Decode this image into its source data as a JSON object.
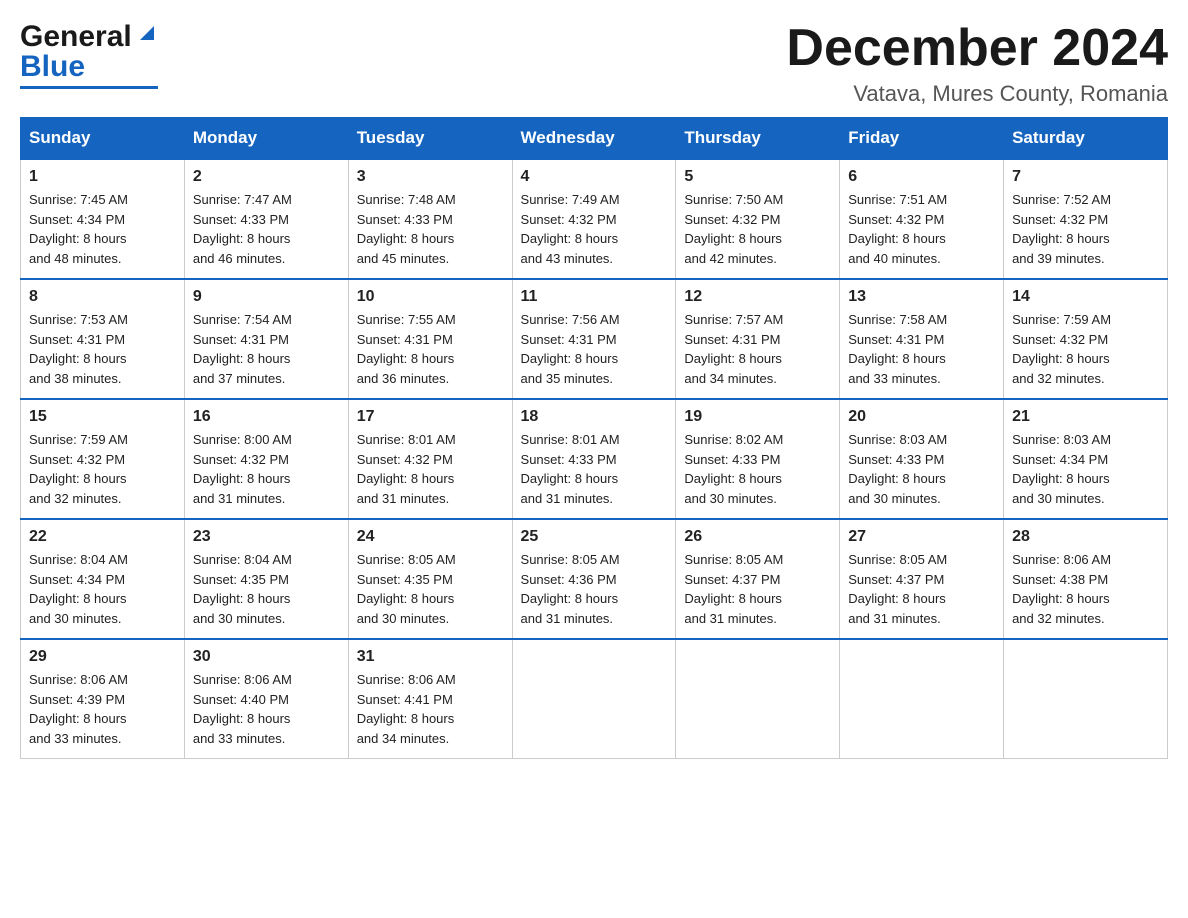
{
  "logo": {
    "general": "General",
    "blue": "Blue"
  },
  "header": {
    "month_title": "December 2024",
    "location": "Vatava, Mures County, Romania"
  },
  "days_of_week": [
    "Sunday",
    "Monday",
    "Tuesday",
    "Wednesday",
    "Thursday",
    "Friday",
    "Saturday"
  ],
  "weeks": [
    [
      {
        "day": "1",
        "sunrise": "7:45 AM",
        "sunset": "4:34 PM",
        "daylight": "8 hours and 48 minutes."
      },
      {
        "day": "2",
        "sunrise": "7:47 AM",
        "sunset": "4:33 PM",
        "daylight": "8 hours and 46 minutes."
      },
      {
        "day": "3",
        "sunrise": "7:48 AM",
        "sunset": "4:33 PM",
        "daylight": "8 hours and 45 minutes."
      },
      {
        "day": "4",
        "sunrise": "7:49 AM",
        "sunset": "4:32 PM",
        "daylight": "8 hours and 43 minutes."
      },
      {
        "day": "5",
        "sunrise": "7:50 AM",
        "sunset": "4:32 PM",
        "daylight": "8 hours and 42 minutes."
      },
      {
        "day": "6",
        "sunrise": "7:51 AM",
        "sunset": "4:32 PM",
        "daylight": "8 hours and 40 minutes."
      },
      {
        "day": "7",
        "sunrise": "7:52 AM",
        "sunset": "4:32 PM",
        "daylight": "8 hours and 39 minutes."
      }
    ],
    [
      {
        "day": "8",
        "sunrise": "7:53 AM",
        "sunset": "4:31 PM",
        "daylight": "8 hours and 38 minutes."
      },
      {
        "day": "9",
        "sunrise": "7:54 AM",
        "sunset": "4:31 PM",
        "daylight": "8 hours and 37 minutes."
      },
      {
        "day": "10",
        "sunrise": "7:55 AM",
        "sunset": "4:31 PM",
        "daylight": "8 hours and 36 minutes."
      },
      {
        "day": "11",
        "sunrise": "7:56 AM",
        "sunset": "4:31 PM",
        "daylight": "8 hours and 35 minutes."
      },
      {
        "day": "12",
        "sunrise": "7:57 AM",
        "sunset": "4:31 PM",
        "daylight": "8 hours and 34 minutes."
      },
      {
        "day": "13",
        "sunrise": "7:58 AM",
        "sunset": "4:31 PM",
        "daylight": "8 hours and 33 minutes."
      },
      {
        "day": "14",
        "sunrise": "7:59 AM",
        "sunset": "4:32 PM",
        "daylight": "8 hours and 32 minutes."
      }
    ],
    [
      {
        "day": "15",
        "sunrise": "7:59 AM",
        "sunset": "4:32 PM",
        "daylight": "8 hours and 32 minutes."
      },
      {
        "day": "16",
        "sunrise": "8:00 AM",
        "sunset": "4:32 PM",
        "daylight": "8 hours and 31 minutes."
      },
      {
        "day": "17",
        "sunrise": "8:01 AM",
        "sunset": "4:32 PM",
        "daylight": "8 hours and 31 minutes."
      },
      {
        "day": "18",
        "sunrise": "8:01 AM",
        "sunset": "4:33 PM",
        "daylight": "8 hours and 31 minutes."
      },
      {
        "day": "19",
        "sunrise": "8:02 AM",
        "sunset": "4:33 PM",
        "daylight": "8 hours and 30 minutes."
      },
      {
        "day": "20",
        "sunrise": "8:03 AM",
        "sunset": "4:33 PM",
        "daylight": "8 hours and 30 minutes."
      },
      {
        "day": "21",
        "sunrise": "8:03 AM",
        "sunset": "4:34 PM",
        "daylight": "8 hours and 30 minutes."
      }
    ],
    [
      {
        "day": "22",
        "sunrise": "8:04 AM",
        "sunset": "4:34 PM",
        "daylight": "8 hours and 30 minutes."
      },
      {
        "day": "23",
        "sunrise": "8:04 AM",
        "sunset": "4:35 PM",
        "daylight": "8 hours and 30 minutes."
      },
      {
        "day": "24",
        "sunrise": "8:05 AM",
        "sunset": "4:35 PM",
        "daylight": "8 hours and 30 minutes."
      },
      {
        "day": "25",
        "sunrise": "8:05 AM",
        "sunset": "4:36 PM",
        "daylight": "8 hours and 31 minutes."
      },
      {
        "day": "26",
        "sunrise": "8:05 AM",
        "sunset": "4:37 PM",
        "daylight": "8 hours and 31 minutes."
      },
      {
        "day": "27",
        "sunrise": "8:05 AM",
        "sunset": "4:37 PM",
        "daylight": "8 hours and 31 minutes."
      },
      {
        "day": "28",
        "sunrise": "8:06 AM",
        "sunset": "4:38 PM",
        "daylight": "8 hours and 32 minutes."
      }
    ],
    [
      {
        "day": "29",
        "sunrise": "8:06 AM",
        "sunset": "4:39 PM",
        "daylight": "8 hours and 33 minutes."
      },
      {
        "day": "30",
        "sunrise": "8:06 AM",
        "sunset": "4:40 PM",
        "daylight": "8 hours and 33 minutes."
      },
      {
        "day": "31",
        "sunrise": "8:06 AM",
        "sunset": "4:41 PM",
        "daylight": "8 hours and 34 minutes."
      },
      null,
      null,
      null,
      null
    ]
  ],
  "labels": {
    "sunrise": "Sunrise: ",
    "sunset": "Sunset: ",
    "daylight": "Daylight: "
  }
}
